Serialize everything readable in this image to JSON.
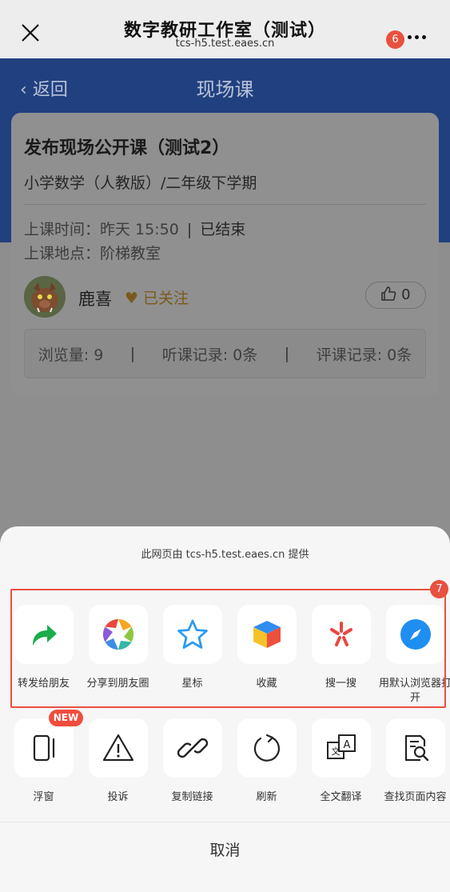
{
  "wechat_bar": {
    "title": "数字教研工作室（测试）",
    "domain": "tcs-h5.test.eaes.cn",
    "badge": "6"
  },
  "page": {
    "back_label": "返回",
    "title": "现场课"
  },
  "lesson": {
    "title": "发布现场公开课（测试2）",
    "subject": "小学数学（人教版）/二年级下学期",
    "time_label": "上课时间：",
    "time_value": "昨天 15:50",
    "time_separator": "|",
    "status": "已结束",
    "location_label": "上课地点：",
    "location_value": "阶梯教室",
    "author": "鹿喜",
    "follow_label": "已关注",
    "like_count": "0",
    "stats": {
      "views": "浏览量: 9",
      "listen": "听课记录: 0条",
      "review": "评课记录: 0条",
      "separator": "|"
    }
  },
  "share_sheet": {
    "provider_text": "此网页由 tcs-h5.test.eaes.cn 提供",
    "highlight_badge": "7",
    "new_badge": "NEW",
    "row1": [
      {
        "label": "转发给朋友",
        "icon": "forward-arrow-icon"
      },
      {
        "label": "分享到朋友圈",
        "icon": "moments-aperture-icon"
      },
      {
        "label": "星标",
        "icon": "star-icon"
      },
      {
        "label": "收藏",
        "icon": "favorites-cube-icon"
      },
      {
        "label": "搜一搜",
        "icon": "search-spark-icon"
      },
      {
        "label": "用默认浏览器打开",
        "icon": "compass-icon"
      }
    ],
    "row2": [
      {
        "label": "浮窗",
        "icon": "float-window-icon"
      },
      {
        "label": "投诉",
        "icon": "warning-icon"
      },
      {
        "label": "复制链接",
        "icon": "link-icon"
      },
      {
        "label": "刷新",
        "icon": "refresh-icon"
      },
      {
        "label": "全文翻译",
        "icon": "translate-icon"
      },
      {
        "label": "查找页面内容",
        "icon": "find-in-page-icon"
      }
    ],
    "cancel_label": "取消"
  },
  "colors": {
    "accent_header": "#2154e0",
    "highlight": "#e8503f",
    "follow": "#f0a22e"
  }
}
